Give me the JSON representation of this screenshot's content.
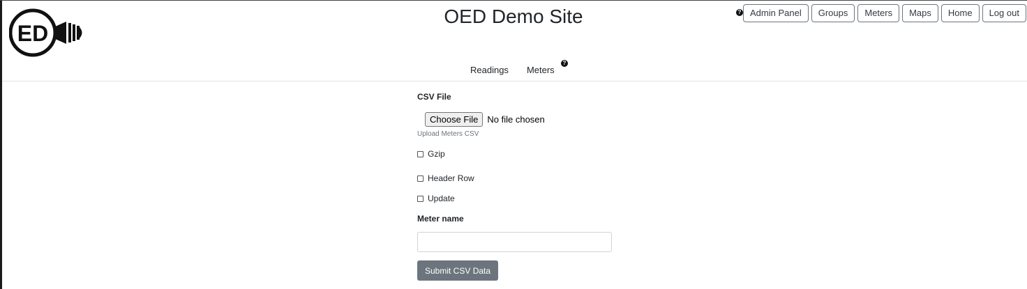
{
  "header": {
    "title": "OED Demo Site",
    "logo_text": "ED",
    "help_icon": "question-circle-icon",
    "nav_buttons": [
      "Admin Panel",
      "Groups",
      "Meters",
      "Maps",
      "Home",
      "Log out"
    ]
  },
  "subnav": {
    "items": [
      "Readings",
      "Meters"
    ],
    "help_icon": "question-circle-icon"
  },
  "form": {
    "csv_file_label": "CSV File",
    "choose_file_label": "Choose File",
    "file_status": "No file chosen",
    "file_help": "Upload Meters CSV",
    "gzip_label": "Gzip",
    "gzip_checked": false,
    "header_row_label": "Header Row",
    "header_row_checked": false,
    "update_label": "Update",
    "update_checked": false,
    "meter_name_label": "Meter name",
    "meter_name_value": "",
    "submit_label": "Submit CSV Data"
  },
  "colors": {
    "submit_bg": "#6c757d",
    "text": "#212529",
    "nav_border": "#6c757d"
  }
}
